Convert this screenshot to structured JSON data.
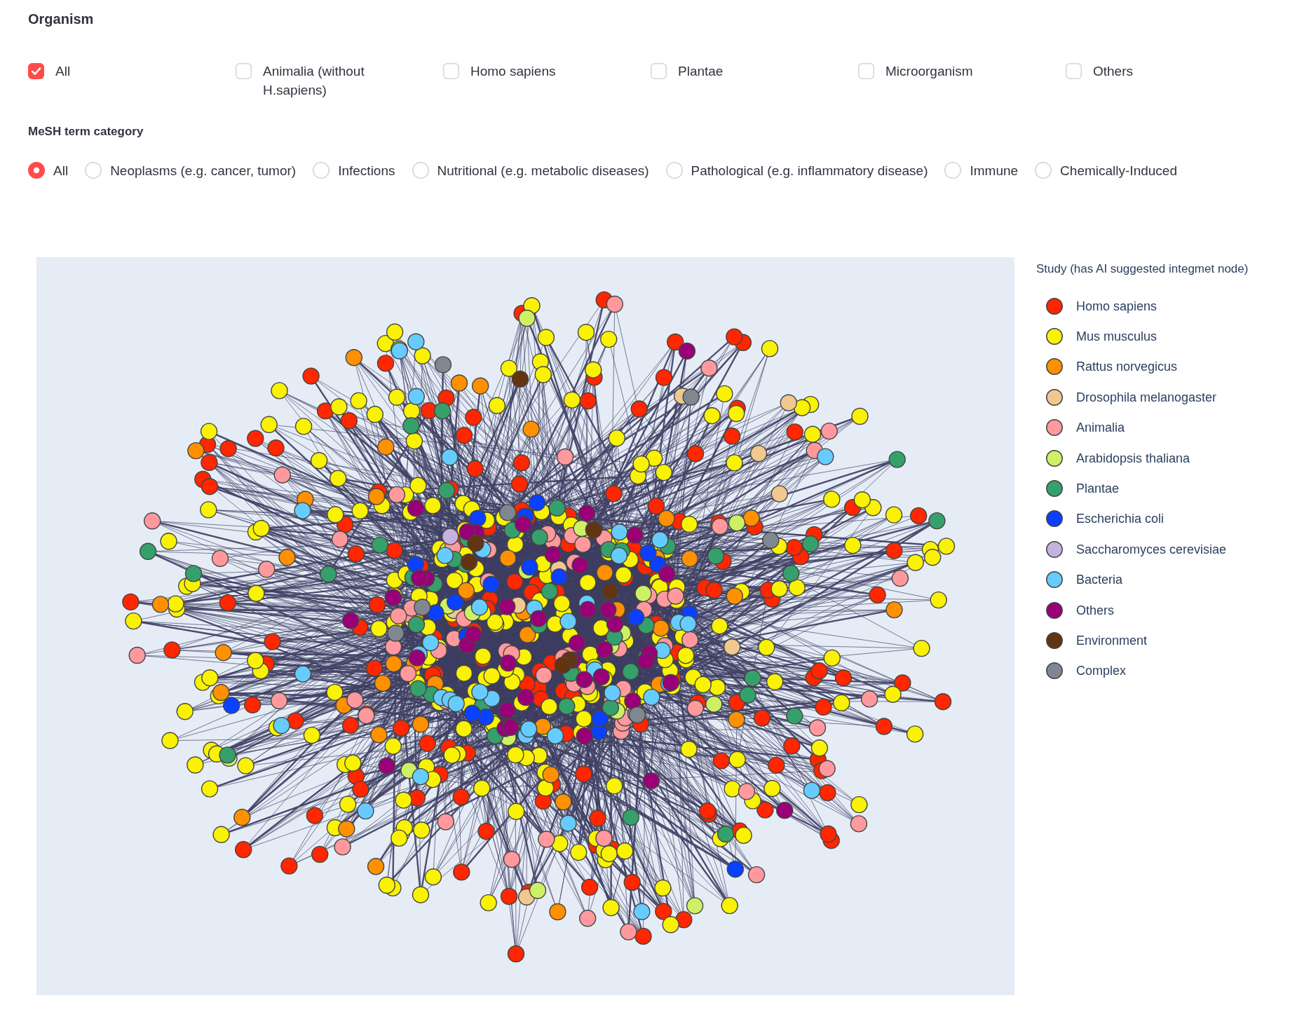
{
  "organism": {
    "title": "Organism",
    "options": [
      {
        "label": "All",
        "checked": true
      },
      {
        "label": "Animalia (without H.sapiens)",
        "checked": false
      },
      {
        "label": "Homo sapiens",
        "checked": false
      },
      {
        "label": "Plantae",
        "checked": false
      },
      {
        "label": "Microorganism",
        "checked": false
      },
      {
        "label": "Others",
        "checked": false
      }
    ]
  },
  "mesh_category": {
    "title": "MeSH term category",
    "options": [
      {
        "label": "All",
        "selected": true
      },
      {
        "label": "Neoplasms (e.g. cancer, tumor)",
        "selected": false
      },
      {
        "label": "Infections",
        "selected": false
      },
      {
        "label": "Nutritional (e.g. metabolic diseases)",
        "selected": false
      },
      {
        "label": "Pathological (e.g. inflammatory disease)",
        "selected": false
      },
      {
        "label": "Immune",
        "selected": false
      },
      {
        "label": "Chemically-Induced",
        "selected": false
      }
    ]
  },
  "network": {
    "legend": {
      "title": "Study (has AI suggested integmet node)",
      "items": [
        {
          "label": "Homo sapiens",
          "color": "#ff2600"
        },
        {
          "label": "Mus musculus",
          "color": "#f9f200"
        },
        {
          "label": "Rattus norvegicus",
          "color": "#ff9000"
        },
        {
          "label": "Drosophila melanogaster",
          "color": "#f0c890"
        },
        {
          "label": "Animalia",
          "color": "#ff999e"
        },
        {
          "label": "Arabidopsis thaliana",
          "color": "#cdf065"
        },
        {
          "label": "Plantae",
          "color": "#35a06b"
        },
        {
          "label": "Escherichia coli",
          "color": "#0a40ff"
        },
        {
          "label": "Saccharomyces cerevisiae",
          "color": "#c7b1df"
        },
        {
          "label": "Bacteria",
          "color": "#66ccff"
        },
        {
          "label": "Others",
          "color": "#990078"
        },
        {
          "label": "Environment",
          "color": "#633412"
        },
        {
          "label": "Complex",
          "color": "#7f8890"
        }
      ]
    }
  }
}
